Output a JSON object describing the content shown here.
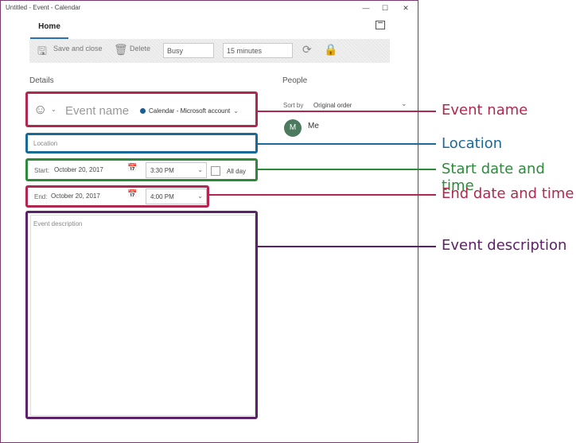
{
  "window": {
    "title": "Untitled - Event - Calendar",
    "controls": {
      "minimize": "—",
      "maximize": "☐",
      "close": "✕"
    }
  },
  "tabs": {
    "home": "Home"
  },
  "toolbar": {
    "save_close_label": "Save and close",
    "delete_label": "Delete",
    "show_as_value": "Busy",
    "reminder_value": "15 minutes"
  },
  "details": {
    "header": "Details",
    "event_name_placeholder": "Event name",
    "calendar_label": "Calendar - Microsoft account",
    "location_placeholder": "Location",
    "start_label": "Start:",
    "start_date": "October 20, 2017",
    "start_time": "3:30 PM",
    "all_day_label": "All day",
    "end_label": "End:",
    "end_date": "October 20, 2017",
    "end_time": "4:00 PM",
    "description_placeholder": "Event description"
  },
  "people": {
    "header": "People",
    "sort_label": "Sort by",
    "sort_value": "Original order",
    "attendee_initial": "M",
    "attendee_name": "Me"
  },
  "callouts": {
    "event_name": "Event name",
    "location": "Location",
    "start": "Start date and time",
    "end": "End date and time",
    "description": "Event description"
  },
  "colors": {
    "event_name": "#b0284f",
    "location": "#1a6a98",
    "start": "#2c8a3a",
    "end": "#b0284f",
    "description": "#5c2168",
    "tab_underline": "#2b6fb4"
  },
  "icons": {
    "emoji": "smiley-icon",
    "save": "save-icon",
    "delete": "trash-icon",
    "repeat": "repeat-icon",
    "private": "lock-icon",
    "calendar_picker": "calendar-icon",
    "popout": "popout-icon"
  }
}
